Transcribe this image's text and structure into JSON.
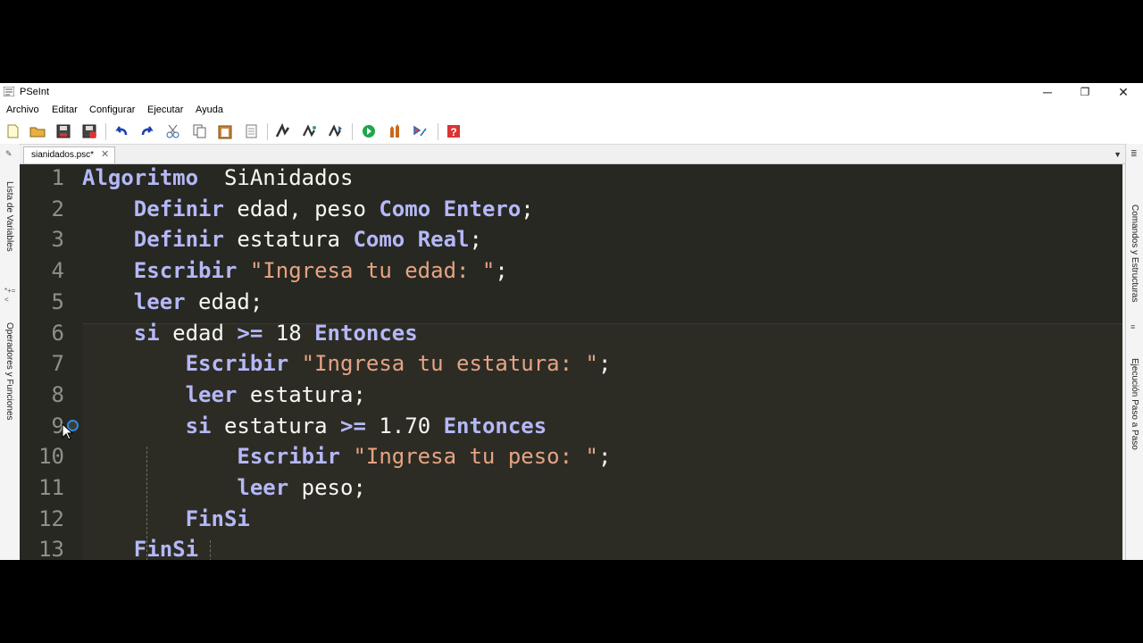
{
  "window": {
    "title": "PSeInt",
    "minimize": "─",
    "maximize": "❐",
    "close": "✕"
  },
  "menu": [
    "Archivo",
    "Editar",
    "Configurar",
    "Ejecutar",
    "Ayuda"
  ],
  "toolbar": {
    "buttons": [
      "new-file-icon",
      "open-file-icon",
      "save-icon",
      "save-as-icon",
      "undo-icon",
      "redo-icon",
      "cut-icon",
      "copy-icon",
      "paste-icon",
      "edit-list-icon",
      "indent-icon",
      "search-icon",
      "find-next-icon",
      "run-icon",
      "step-run-icon",
      "debug-icon",
      "help-icon"
    ]
  },
  "left_panel": {
    "tab1": "Lista de Variables",
    "tab2": "Operadores y Funciones",
    "icon1": "*+=<"
  },
  "right_panel": {
    "tab1": "Comandos y Estructuras",
    "tab2": "Ejecución Paso a Paso"
  },
  "tab": {
    "filename": "sianidados.psc*",
    "close": "✕",
    "dropdown": "▼"
  },
  "colors": {
    "editor_bg": "#272822",
    "keyword": "#b5b8f7",
    "string": "#e6a383",
    "breakpoint": "#2e8bd8"
  },
  "code_lines": [
    {
      "n": "1",
      "tokens": [
        [
          "kw",
          "Algoritmo"
        ],
        [
          "",
          "  SiAnidados"
        ]
      ]
    },
    {
      "n": "2",
      "tokens": [
        [
          "",
          "    "
        ],
        [
          "kw",
          "Definir"
        ],
        [
          "",
          " edad, peso "
        ],
        [
          "kw",
          "Como"
        ],
        [
          "",
          " "
        ],
        [
          "kw",
          "Entero"
        ],
        [
          "",
          ";"
        ]
      ]
    },
    {
      "n": "3",
      "tokens": [
        [
          "",
          "    "
        ],
        [
          "kw",
          "Definir"
        ],
        [
          "",
          " estatura "
        ],
        [
          "kw",
          "Como"
        ],
        [
          "",
          " "
        ],
        [
          "kw",
          "Real"
        ],
        [
          "",
          ";"
        ]
      ]
    },
    {
      "n": "4",
      "tokens": [
        [
          "",
          "    "
        ],
        [
          "kw",
          "Escribir"
        ],
        [
          "",
          " "
        ],
        [
          "str",
          "\"Ingresa tu edad: \""
        ],
        [
          "",
          ";"
        ]
      ]
    },
    {
      "n": "5",
      "tokens": [
        [
          "",
          "    "
        ],
        [
          "kw",
          "leer"
        ],
        [
          "",
          " edad;"
        ]
      ]
    },
    {
      "n": "6",
      "tokens": [
        [
          "",
          "    "
        ],
        [
          "kw",
          "si"
        ],
        [
          "",
          " edad "
        ],
        [
          "kw",
          ">="
        ],
        [
          "",
          " 18 "
        ],
        [
          "kw",
          "Entonces"
        ]
      ]
    },
    {
      "n": "7",
      "tokens": [
        [
          "",
          "        "
        ],
        [
          "kw",
          "Escribir"
        ],
        [
          "",
          " "
        ],
        [
          "str",
          "\"Ingresa tu estatura: \""
        ],
        [
          "",
          ";"
        ]
      ]
    },
    {
      "n": "8",
      "tokens": [
        [
          "",
          "        "
        ],
        [
          "kw",
          "leer"
        ],
        [
          "",
          " estatura;"
        ]
      ]
    },
    {
      "n": "9",
      "tokens": [
        [
          "",
          "        "
        ],
        [
          "kw",
          "si"
        ],
        [
          "",
          " estatura "
        ],
        [
          "kw",
          ">="
        ],
        [
          "",
          " 1.70 "
        ],
        [
          "kw",
          "Entonces"
        ]
      ]
    },
    {
      "n": "10",
      "tokens": [
        [
          "",
          "            "
        ],
        [
          "kw",
          "Escribir"
        ],
        [
          "",
          " "
        ],
        [
          "str",
          "\"Ingresa tu peso: \""
        ],
        [
          "",
          ";"
        ]
      ]
    },
    {
      "n": "11",
      "tokens": [
        [
          "",
          "            "
        ],
        [
          "kw",
          "leer"
        ],
        [
          "",
          " peso;"
        ]
      ]
    },
    {
      "n": "12",
      "tokens": [
        [
          "",
          "        "
        ],
        [
          "kw",
          "FinSi"
        ]
      ]
    },
    {
      "n": "13",
      "tokens": [
        [
          "",
          "    "
        ],
        [
          "kw",
          "FinSi"
        ]
      ]
    }
  ]
}
